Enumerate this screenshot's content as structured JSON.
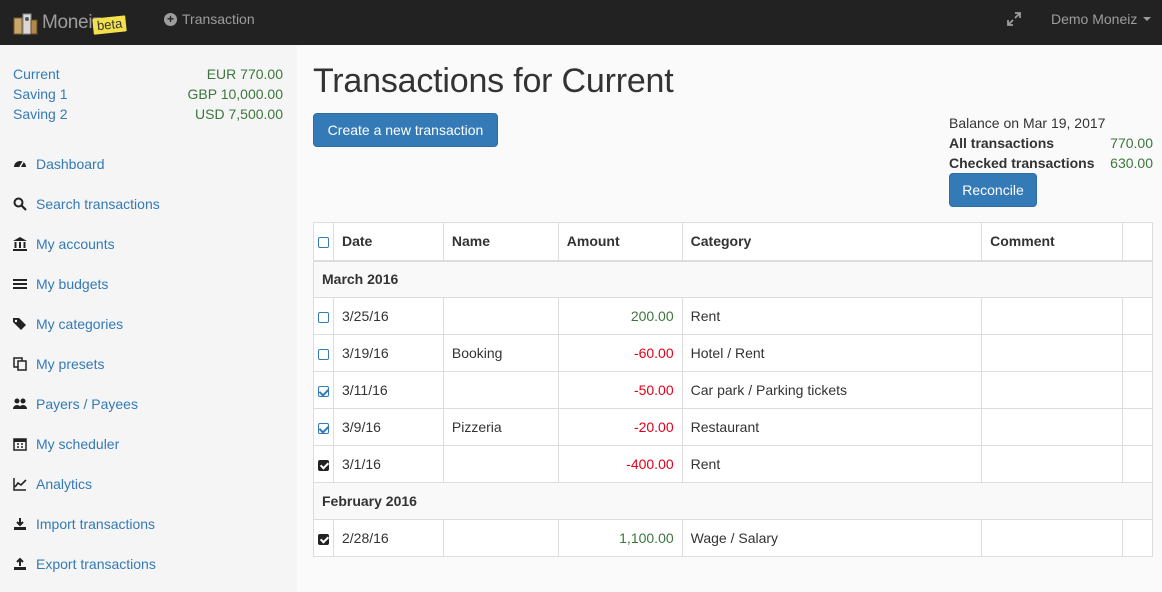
{
  "nav": {
    "brand": "Moneiz",
    "beta": "beta",
    "transaction_link": "Transaction",
    "user": "Demo Moneiz"
  },
  "accounts": [
    {
      "name": "Current",
      "balance": "EUR 770.00"
    },
    {
      "name": "Saving 1",
      "balance": "GBP 10,000.00"
    },
    {
      "name": "Saving 2",
      "balance": "USD 7,500.00"
    }
  ],
  "sidebar": {
    "items": [
      {
        "label": "Dashboard",
        "icon": "dashboard-icon"
      },
      {
        "label": "Search transactions",
        "icon": "search-icon"
      },
      {
        "label": "My accounts",
        "icon": "bank-icon"
      },
      {
        "label": "My budgets",
        "icon": "list-icon"
      },
      {
        "label": "My categories",
        "icon": "tags-icon"
      },
      {
        "label": "My presets",
        "icon": "copy-icon"
      },
      {
        "label": "Payers / Payees",
        "icon": "users-icon"
      },
      {
        "label": "My scheduler",
        "icon": "calendar-icon"
      },
      {
        "label": "Analytics",
        "icon": "chart-icon"
      },
      {
        "label": "Import transactions",
        "icon": "import-icon"
      },
      {
        "label": "Export transactions",
        "icon": "export-icon"
      }
    ]
  },
  "main": {
    "title": "Transactions for Current",
    "create_button": "Create a new transaction",
    "balance_heading": "Balance on Mar 19, 2017",
    "all_label": "All transactions",
    "all_value": "770.00",
    "checked_label": "Checked transactions",
    "checked_value": "630.00",
    "reconcile_button": "Reconcile"
  },
  "table": {
    "headers": {
      "date": "Date",
      "name": "Name",
      "amount": "Amount",
      "category": "Category",
      "comment": "Comment"
    },
    "groups": [
      {
        "label": "March 2016",
        "rows": [
          {
            "date": "3/25/16",
            "name": "",
            "amount": "200.00",
            "sign": "pos",
            "category": "Rent",
            "comment": "",
            "check": "none"
          },
          {
            "date": "3/19/16",
            "name": "Booking",
            "amount": "-60.00",
            "sign": "neg",
            "category": "Hotel / Rent",
            "comment": "",
            "check": "none"
          },
          {
            "date": "3/11/16",
            "name": "",
            "amount": "-50.00",
            "sign": "neg",
            "category": "Car park / Parking tickets",
            "comment": "",
            "check": "half"
          },
          {
            "date": "3/9/16",
            "name": "Pizzeria",
            "amount": "-20.00",
            "sign": "neg",
            "category": "Restaurant",
            "comment": "",
            "check": "half"
          },
          {
            "date": "3/1/16",
            "name": "",
            "amount": "-400.00",
            "sign": "neg",
            "category": "Rent",
            "comment": "",
            "check": "full"
          }
        ]
      },
      {
        "label": "February 2016",
        "rows": [
          {
            "date": "2/28/16",
            "name": "",
            "amount": "1,100.00",
            "sign": "pos",
            "category": "Wage / Salary",
            "comment": "",
            "check": "full"
          }
        ]
      }
    ]
  },
  "colors": {
    "primary": "#337ab7",
    "positive": "#3c763d",
    "negative": "#e3001b",
    "navbar": "#222222"
  }
}
